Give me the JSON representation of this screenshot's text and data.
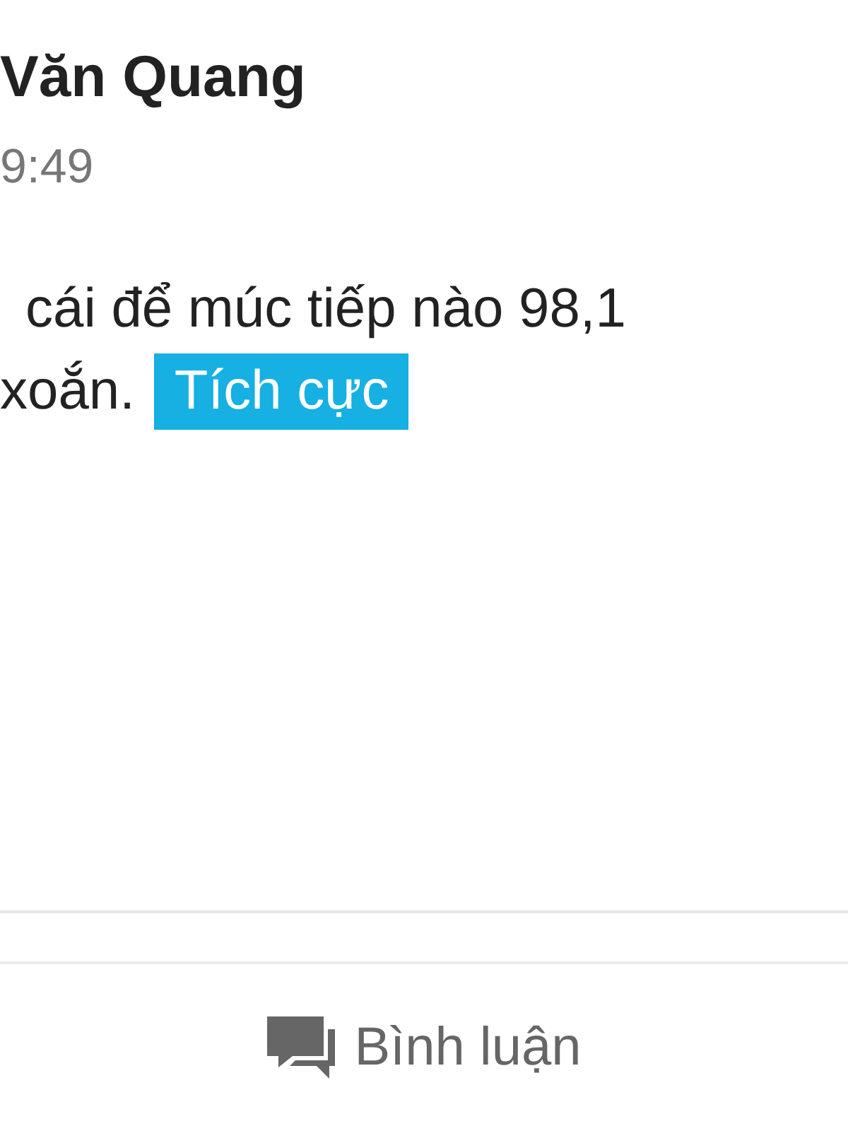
{
  "post": {
    "author": "Văn Quang",
    "time": "9:49",
    "body_lines": [
      "cái để múc tiếp nào 98,1",
      "xoắn."
    ],
    "tag": {
      "label": "Tích cực",
      "color": "#16b0e2"
    }
  },
  "actions": [
    {
      "label": "Bình luận"
    }
  ]
}
